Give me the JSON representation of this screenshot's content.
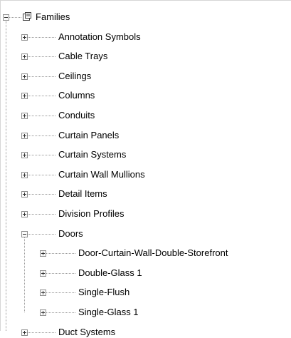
{
  "tree": {
    "root": {
      "label": "Families",
      "icon": "families-icon",
      "expanded": true
    },
    "categories": [
      {
        "label": "Annotation Symbols",
        "expanded": false
      },
      {
        "label": "Cable Trays",
        "expanded": false
      },
      {
        "label": "Ceilings",
        "expanded": false
      },
      {
        "label": "Columns",
        "expanded": false
      },
      {
        "label": "Conduits",
        "expanded": false
      },
      {
        "label": "Curtain Panels",
        "expanded": false
      },
      {
        "label": "Curtain Systems",
        "expanded": false
      },
      {
        "label": "Curtain Wall Mullions",
        "expanded": false
      },
      {
        "label": "Detail Items",
        "expanded": false
      },
      {
        "label": "Division Profiles",
        "expanded": false
      },
      {
        "label": "Doors",
        "expanded": true,
        "children": [
          {
            "label": "Door-Curtain-Wall-Double-Storefront",
            "expanded": false
          },
          {
            "label": "Double-Glass 1",
            "expanded": false
          },
          {
            "label": "Single-Flush",
            "expanded": false
          },
          {
            "label": "Single-Glass 1",
            "expanded": false
          }
        ]
      },
      {
        "label": "Duct Systems",
        "expanded": false
      }
    ]
  },
  "colors": {
    "connector": "#9a9a9a",
    "background": "#ffffff",
    "text": "#000000"
  }
}
